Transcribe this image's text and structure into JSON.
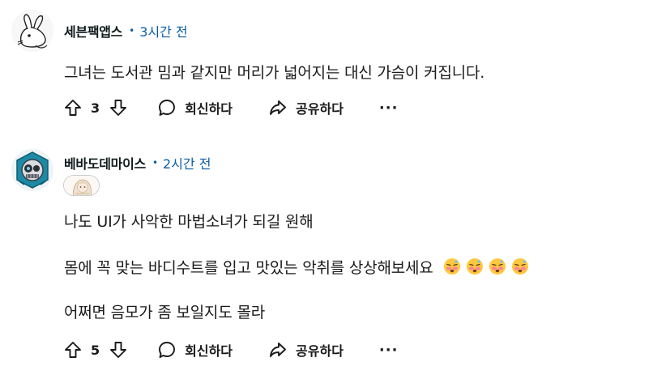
{
  "comments": [
    {
      "author": "세븐팩앱스",
      "time": "3시간 전",
      "body": [
        "그녀는 도서관 밈과 같지만 머리가 넓어지는 대신 가슴이 커집니다."
      ],
      "score": "3",
      "reply_label": "회신하다",
      "share_label": "공유하다",
      "avatar": "rabbit-sketch-avatar"
    },
    {
      "author": "베바도데마이스",
      "time": "2시간 전",
      "body": [
        "나도 UI가 사악한 마법소녀가 되길 원해",
        "몸에 꼭 맞는 바디수트를 입고 맛있는 악취를 상상해보세요",
        "어쩌면 음모가 좀 보일지도 몰라"
      ],
      "score": "5",
      "reply_label": "회신하다",
      "share_label": "공유하다",
      "avatar": "robot-skull-avatar",
      "flair": "anime-character-flair",
      "emojis": [
        "flushed-face-emoji",
        "flushed-face-emoji",
        "flushed-face-emoji",
        "flushed-face-emoji"
      ]
    }
  ],
  "more_label": "···",
  "icons": {
    "upvote": "upvote-arrow-icon",
    "downvote": "downvote-arrow-icon",
    "reply": "speech-bubble-icon",
    "share": "share-arrow-icon"
  },
  "colors": {
    "time": "#0a5ea8",
    "text": "#1a1a1b"
  }
}
